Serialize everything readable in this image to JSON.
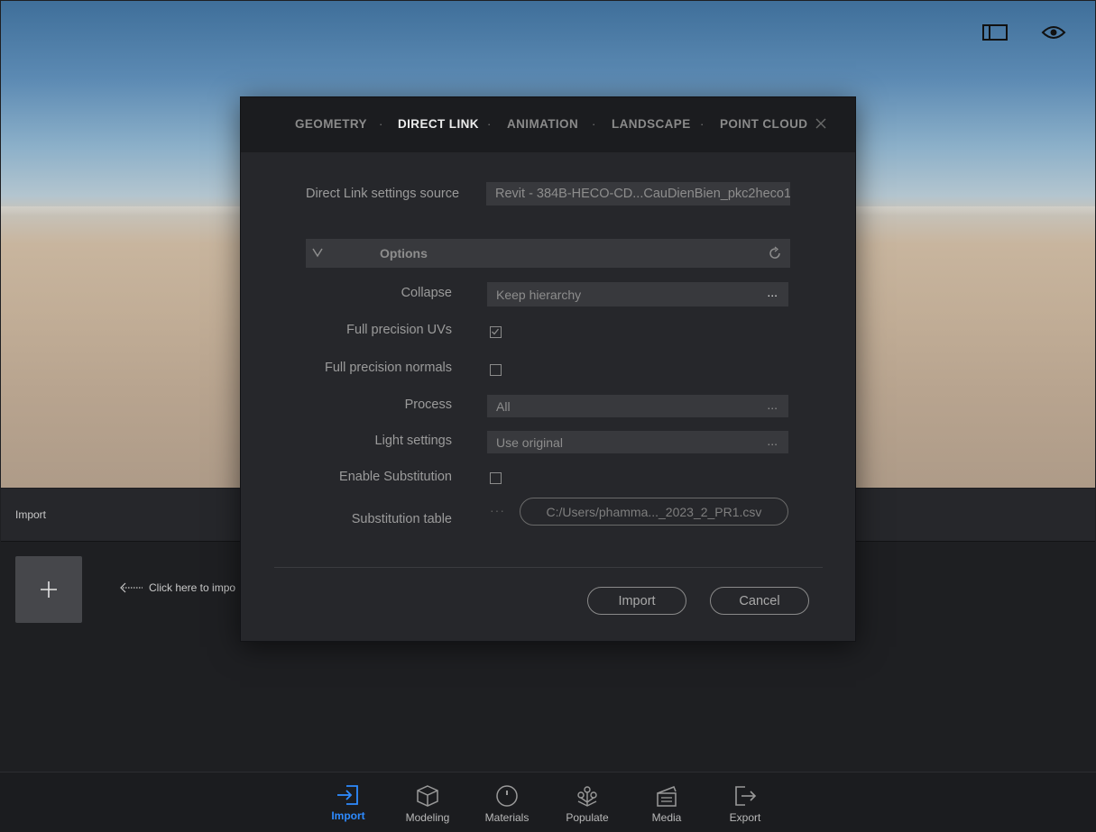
{
  "import_panel": {
    "title": "Import",
    "hint": "Click here to impo"
  },
  "toolbar": {
    "items": [
      {
        "label": "Import",
        "icon": "import-icon",
        "active": true
      },
      {
        "label": "Modeling",
        "icon": "cube-icon"
      },
      {
        "label": "Materials",
        "icon": "circle-dot-icon"
      },
      {
        "label": "Populate",
        "icon": "tree-icon"
      },
      {
        "label": "Media",
        "icon": "clapper-icon"
      },
      {
        "label": "Export",
        "icon": "export-icon"
      }
    ]
  },
  "dialog": {
    "tabs": [
      {
        "label": "GEOMETRY"
      },
      {
        "label": "DIRECT LINK",
        "active": true
      },
      {
        "label": "ANIMATION"
      },
      {
        "label": "LANDSCAPE"
      },
      {
        "label": "POINT CLOUD"
      }
    ],
    "tab_separator": "·",
    "source_label": "Direct Link settings source",
    "source_value": "Revit - 384B-HECO-CD...CauDienBien_pkc2heco1",
    "options_title": "Options",
    "collapse": {
      "label": "Collapse",
      "value": "Keep hierarchy",
      "dots": "..."
    },
    "full_precision_uvs": {
      "label": "Full precision UVs",
      "checked": true
    },
    "full_precision_normals": {
      "label": "Full precision normals",
      "checked": false
    },
    "process": {
      "label": "Process",
      "value": "All",
      "dots": "..."
    },
    "light_settings": {
      "label": "Light settings",
      "value": "Use original",
      "dots": "..."
    },
    "enable_substitution": {
      "label": "Enable Substitution",
      "checked": false
    },
    "substitution_table": {
      "label": "Substitution table",
      "value": "C:/Users/phamma..._2023_2_PR1.csv",
      "dots": "···"
    },
    "import_button": "Import",
    "cancel_button": "Cancel"
  },
  "colors": {
    "accent": "#2e8bff",
    "modal_bg": "#26272b",
    "field_bg": "#38393d"
  }
}
